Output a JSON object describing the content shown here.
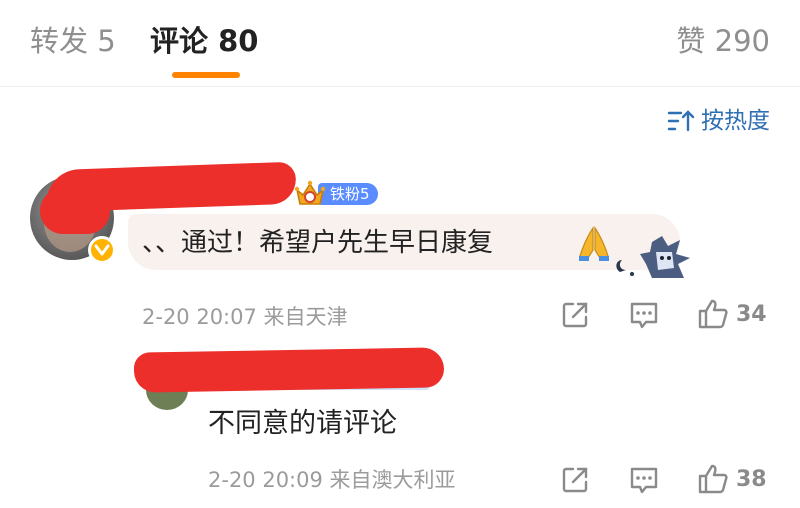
{
  "tabs": {
    "repost": "转发 5",
    "comments": "评论 80",
    "likes": "赞 290"
  },
  "sort": {
    "label": "按热度",
    "icon": "sort-icon"
  },
  "comments": [
    {
      "fan_badge": "铁粉5",
      "text": "、、通过！希望户先生早日康复",
      "emoji": "pray-hands-icon",
      "time": "2-20 20:07",
      "location": "来自天津",
      "likes": "34",
      "verified": true
    }
  ],
  "reply": {
    "text": "不同意的请评论",
    "time": "2-20 20:09",
    "location": "来自澳大利亚",
    "likes": "38"
  },
  "colors": {
    "accent": "#ff8200",
    "link": "#2f6fb3",
    "redaction": "#ec2f2b",
    "bubble": "#f8f1ee",
    "fan_badge": "#5a8cff",
    "verified": "#ffb300"
  }
}
